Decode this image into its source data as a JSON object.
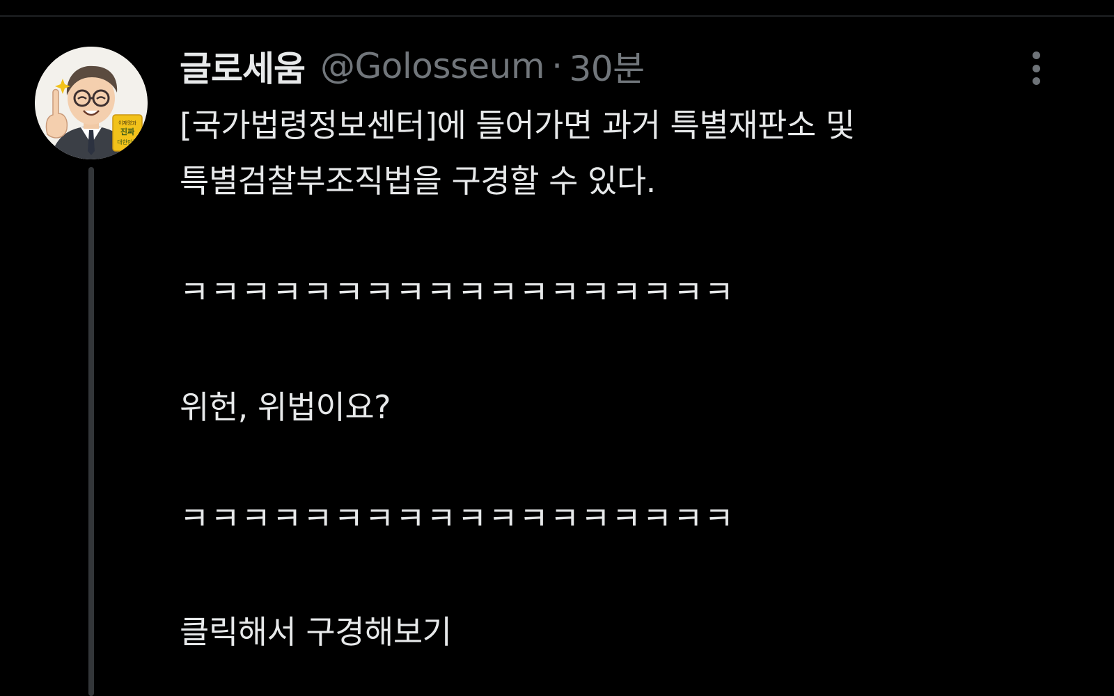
{
  "tweet": {
    "author": {
      "display_name": "글로세움",
      "handle": "@Golosseum",
      "avatar_badge_lines": [
        "이재명과",
        "진짜",
        "대한민국"
      ]
    },
    "separator": "·",
    "time": "30분",
    "lines": [
      "[국가법령정보센터]에 들어가면 과거 특별재판소 및",
      "특별검찰부조직법을 구경할 수 있다.",
      "ㅋㅋㅋㅋㅋㅋㅋㅋㅋㅋㅋㅋㅋㅋㅋㅋㅋㅋ",
      "위헌, 위법이요?",
      "ㅋㅋㅋㅋㅋㅋㅋㅋㅋㅋㅋㅋㅋㅋㅋㅋㅋㅋ",
      "클릭해서 구경해보기"
    ],
    "more_icon": "more-vertical-icon"
  },
  "colors": {
    "background": "#000000",
    "text_primary": "#e7e9ea",
    "text_secondary": "#71767b",
    "thread_line": "#333639",
    "badge_yellow": "#f2c21a"
  }
}
